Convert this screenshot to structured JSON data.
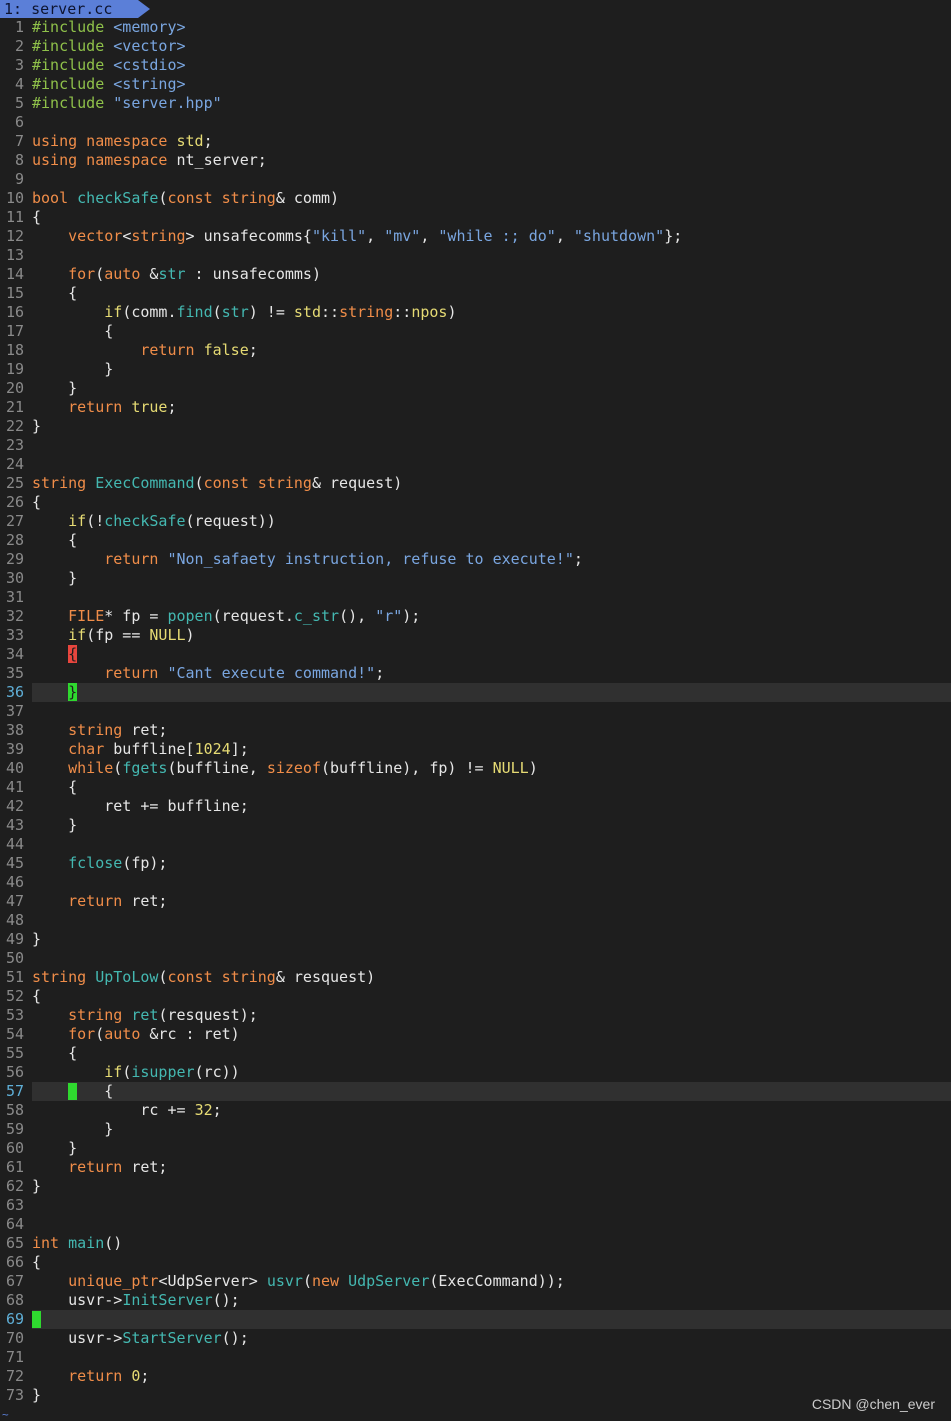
{
  "tab": {
    "label": "1: server.cc"
  },
  "watermark": "CSDN @chen_ever",
  "lines": [
    {
      "n": "1",
      "t": [
        [
          "pp",
          "#include "
        ],
        [
          "str",
          "<memory>"
        ]
      ]
    },
    {
      "n": "2",
      "t": [
        [
          "pp",
          "#include "
        ],
        [
          "str",
          "<vector>"
        ]
      ]
    },
    {
      "n": "3",
      "t": [
        [
          "pp",
          "#include "
        ],
        [
          "str",
          "<cstdio>"
        ]
      ]
    },
    {
      "n": "4",
      "t": [
        [
          "pp",
          "#include "
        ],
        [
          "str",
          "<string>"
        ]
      ]
    },
    {
      "n": "5",
      "t": [
        [
          "pp",
          "#include "
        ],
        [
          "str",
          "\"server.hpp\""
        ]
      ]
    },
    {
      "n": "6",
      "t": []
    },
    {
      "n": "7",
      "t": [
        [
          "kw",
          "using namespace "
        ],
        [
          "cst",
          "std"
        ],
        [
          "",
          "; "
        ]
      ]
    },
    {
      "n": "8",
      "t": [
        [
          "kw",
          "using namespace "
        ],
        [
          "",
          "nt_server;"
        ]
      ]
    },
    {
      "n": "9",
      "t": []
    },
    {
      "n": "10",
      "t": [
        [
          "kw",
          "bool "
        ],
        [
          "fn",
          "checkSafe"
        ],
        [
          "",
          "("
        ],
        [
          "kw",
          "const string"
        ],
        [
          "",
          "& comm)"
        ]
      ]
    },
    {
      "n": "11",
      "t": [
        [
          "",
          "{"
        ]
      ]
    },
    {
      "n": "12",
      "t": [
        [
          "",
          "    "
        ],
        [
          "kw",
          "vector"
        ],
        [
          "",
          "<"
        ],
        [
          "kw",
          "string"
        ],
        [
          "",
          "> unsafecomms{"
        ],
        [
          "str",
          "\"kill\""
        ],
        [
          "",
          ", "
        ],
        [
          "str",
          "\"mv\""
        ],
        [
          "",
          ", "
        ],
        [
          "str",
          "\"while :; do\""
        ],
        [
          "",
          ", "
        ],
        [
          "str",
          "\"shutdown\""
        ],
        [
          "",
          "};"
        ]
      ]
    },
    {
      "n": "13",
      "t": []
    },
    {
      "n": "14",
      "t": [
        [
          "",
          "    "
        ],
        [
          "kw",
          "for"
        ],
        [
          "",
          "("
        ],
        [
          "kw",
          "auto "
        ],
        [
          "",
          "&"
        ],
        [
          "fn",
          "str"
        ],
        [
          "",
          " : unsafecomms)"
        ]
      ]
    },
    {
      "n": "15",
      "t": [
        [
          "",
          "    {"
        ]
      ]
    },
    {
      "n": "16",
      "t": [
        [
          "",
          "        "
        ],
        [
          "cst",
          "if"
        ],
        [
          "",
          "(comm."
        ],
        [
          "fn",
          "find"
        ],
        [
          "",
          "("
        ],
        [
          "fn",
          "str"
        ],
        [
          "",
          ") != "
        ],
        [
          "cst",
          "std"
        ],
        [
          "",
          "::"
        ],
        [
          "kw",
          "string"
        ],
        [
          "",
          "::"
        ],
        [
          "cst",
          "npos"
        ],
        [
          "",
          ")"
        ]
      ]
    },
    {
      "n": "17",
      "t": [
        [
          "",
          "        {"
        ]
      ]
    },
    {
      "n": "18",
      "t": [
        [
          "",
          "            "
        ],
        [
          "kw",
          "return "
        ],
        [
          "cst",
          "false"
        ],
        [
          "",
          ";"
        ]
      ]
    },
    {
      "n": "19",
      "t": [
        [
          "",
          "        }"
        ]
      ]
    },
    {
      "n": "20",
      "t": [
        [
          "",
          "    }"
        ]
      ]
    },
    {
      "n": "21",
      "t": [
        [
          "",
          "    "
        ],
        [
          "kw",
          "return "
        ],
        [
          "cst",
          "true"
        ],
        [
          "",
          ";"
        ]
      ]
    },
    {
      "n": "22",
      "t": [
        [
          "",
          "}"
        ]
      ]
    },
    {
      "n": "23",
      "t": []
    },
    {
      "n": "24",
      "t": []
    },
    {
      "n": "25",
      "t": [
        [
          "kw",
          "string "
        ],
        [
          "fn",
          "ExecCommand"
        ],
        [
          "",
          "("
        ],
        [
          "kw",
          "const string"
        ],
        [
          "",
          "& request)"
        ]
      ]
    },
    {
      "n": "26",
      "t": [
        [
          "",
          "{"
        ]
      ]
    },
    {
      "n": "27",
      "t": [
        [
          "",
          "    "
        ],
        [
          "cst",
          "if"
        ],
        [
          "",
          "(!"
        ],
        [
          "fn",
          "checkSafe"
        ],
        [
          "",
          "(request))"
        ]
      ]
    },
    {
      "n": "28",
      "t": [
        [
          "",
          "    {"
        ]
      ]
    },
    {
      "n": "29",
      "t": [
        [
          "",
          "        "
        ],
        [
          "kw",
          "return "
        ],
        [
          "str",
          "\"Non_safaety instruction, refuse to execute!\""
        ],
        [
          "",
          ";"
        ]
      ]
    },
    {
      "n": "30",
      "t": [
        [
          "",
          "    }"
        ]
      ]
    },
    {
      "n": "31",
      "t": []
    },
    {
      "n": "32",
      "t": [
        [
          "",
          "    "
        ],
        [
          "kw",
          "FILE"
        ],
        [
          "",
          "* fp = "
        ],
        [
          "fn",
          "popen"
        ],
        [
          "",
          "(request."
        ],
        [
          "fn",
          "c_str"
        ],
        [
          "",
          "(), "
        ],
        [
          "str",
          "\"r\""
        ],
        [
          "",
          ");"
        ]
      ]
    },
    {
      "n": "33",
      "t": [
        [
          "",
          "    "
        ],
        [
          "cst",
          "if"
        ],
        [
          "",
          "(fp == "
        ],
        [
          "cst",
          "NULL"
        ],
        [
          "",
          ")"
        ]
      ]
    },
    {
      "n": "34",
      "t": [
        [
          "",
          "    "
        ],
        [
          "hl-red",
          "{"
        ]
      ]
    },
    {
      "n": "35",
      "t": [
        [
          "",
          "        "
        ],
        [
          "kw",
          "return "
        ],
        [
          "str",
          "\"Cant execute command!\""
        ],
        [
          "",
          ";"
        ]
      ]
    },
    {
      "n": "36",
      "cur": true,
      "t": [
        [
          "",
          "    "
        ],
        [
          "hl-green",
          "}"
        ]
      ]
    },
    {
      "n": "37",
      "t": []
    },
    {
      "n": "38",
      "t": [
        [
          "",
          "    "
        ],
        [
          "kw",
          "string "
        ],
        [
          "",
          "ret;"
        ]
      ]
    },
    {
      "n": "39",
      "t": [
        [
          "",
          "    "
        ],
        [
          "kw",
          "char "
        ],
        [
          "",
          "buffline["
        ],
        [
          "num",
          "1024"
        ],
        [
          "",
          "];"
        ]
      ]
    },
    {
      "n": "40",
      "t": [
        [
          "",
          "    "
        ],
        [
          "kw",
          "while"
        ],
        [
          "",
          "("
        ],
        [
          "fn",
          "fgets"
        ],
        [
          "",
          "(buffline, "
        ],
        [
          "kw",
          "sizeof"
        ],
        [
          "",
          "(buffline), fp) != "
        ],
        [
          "cst",
          "NULL"
        ],
        [
          "",
          ")"
        ]
      ]
    },
    {
      "n": "41",
      "t": [
        [
          "",
          "    {"
        ]
      ]
    },
    {
      "n": "42",
      "t": [
        [
          "",
          "        ret += buffline;"
        ]
      ]
    },
    {
      "n": "43",
      "t": [
        [
          "",
          "    }"
        ]
      ]
    },
    {
      "n": "44",
      "t": []
    },
    {
      "n": "45",
      "t": [
        [
          "",
          "    "
        ],
        [
          "fn",
          "fclose"
        ],
        [
          "",
          "(fp);"
        ]
      ]
    },
    {
      "n": "46",
      "t": []
    },
    {
      "n": "47",
      "t": [
        [
          "",
          "    "
        ],
        [
          "kw",
          "return "
        ],
        [
          "",
          "ret;"
        ]
      ]
    },
    {
      "n": "48",
      "t": []
    },
    {
      "n": "49",
      "t": [
        [
          "",
          "}"
        ]
      ]
    },
    {
      "n": "50",
      "t": []
    },
    {
      "n": "51",
      "t": [
        [
          "kw",
          "string "
        ],
        [
          "fn",
          "UpToLow"
        ],
        [
          "",
          "("
        ],
        [
          "kw",
          "const string"
        ],
        [
          "",
          "& resquest)"
        ]
      ]
    },
    {
      "n": "52",
      "t": [
        [
          "",
          "{"
        ]
      ]
    },
    {
      "n": "53",
      "t": [
        [
          "",
          "    "
        ],
        [
          "kw",
          "string "
        ],
        [
          "fn",
          "ret"
        ],
        [
          "",
          "(resquest);"
        ]
      ]
    },
    {
      "n": "54",
      "t": [
        [
          "",
          "    "
        ],
        [
          "kw",
          "for"
        ],
        [
          "",
          "("
        ],
        [
          "kw",
          "auto "
        ],
        [
          "",
          "&rc : ret)"
        ]
      ]
    },
    {
      "n": "55",
      "t": [
        [
          "",
          "    {"
        ]
      ]
    },
    {
      "n": "56",
      "t": [
        [
          "",
          "        "
        ],
        [
          "cst",
          "if"
        ],
        [
          "",
          "("
        ],
        [
          "fn",
          "isupper"
        ],
        [
          "",
          "(rc))"
        ]
      ]
    },
    {
      "n": "57",
      "cur": true,
      "t": [
        [
          "",
          "    "
        ],
        [
          "cursor",
          ""
        ],
        [
          "",
          "   {"
        ]
      ]
    },
    {
      "n": "58",
      "t": [
        [
          "",
          "            rc += "
        ],
        [
          "num",
          "32"
        ],
        [
          "",
          ";"
        ]
      ]
    },
    {
      "n": "59",
      "t": [
        [
          "",
          "        }"
        ]
      ]
    },
    {
      "n": "60",
      "t": [
        [
          "",
          "    }"
        ]
      ]
    },
    {
      "n": "61",
      "t": [
        [
          "",
          "    "
        ],
        [
          "kw",
          "return "
        ],
        [
          "",
          "ret;"
        ]
      ]
    },
    {
      "n": "62",
      "t": [
        [
          "",
          "}"
        ]
      ]
    },
    {
      "n": "63",
      "t": []
    },
    {
      "n": "64",
      "t": []
    },
    {
      "n": "65",
      "t": [
        [
          "kw",
          "int "
        ],
        [
          "fn",
          "main"
        ],
        [
          "",
          "()"
        ]
      ]
    },
    {
      "n": "66",
      "t": [
        [
          "",
          "{"
        ]
      ]
    },
    {
      "n": "67",
      "t": [
        [
          "",
          "    "
        ],
        [
          "kw",
          "unique_ptr"
        ],
        [
          "",
          "<UdpServer> "
        ],
        [
          "fn",
          "usvr"
        ],
        [
          "",
          "("
        ],
        [
          "kw",
          "new "
        ],
        [
          "fn",
          "UdpServer"
        ],
        [
          "",
          "(ExecCommand));"
        ]
      ]
    },
    {
      "n": "68",
      "t": [
        [
          "",
          "    usvr->"
        ],
        [
          "fn",
          "InitServer"
        ],
        [
          "",
          "();"
        ]
      ]
    },
    {
      "n": "69",
      "cur": true,
      "t": [
        [
          "cursor",
          ""
        ]
      ]
    },
    {
      "n": "70",
      "t": [
        [
          "",
          "    usvr->"
        ],
        [
          "fn",
          "StartServer"
        ],
        [
          "",
          "();"
        ]
      ]
    },
    {
      "n": "71",
      "t": []
    },
    {
      "n": "72",
      "t": [
        [
          "",
          "    "
        ],
        [
          "kw",
          "return "
        ],
        [
          "num",
          "0"
        ],
        [
          "",
          ";"
        ]
      ]
    },
    {
      "n": "73",
      "t": [
        [
          "",
          "}"
        ]
      ]
    }
  ]
}
